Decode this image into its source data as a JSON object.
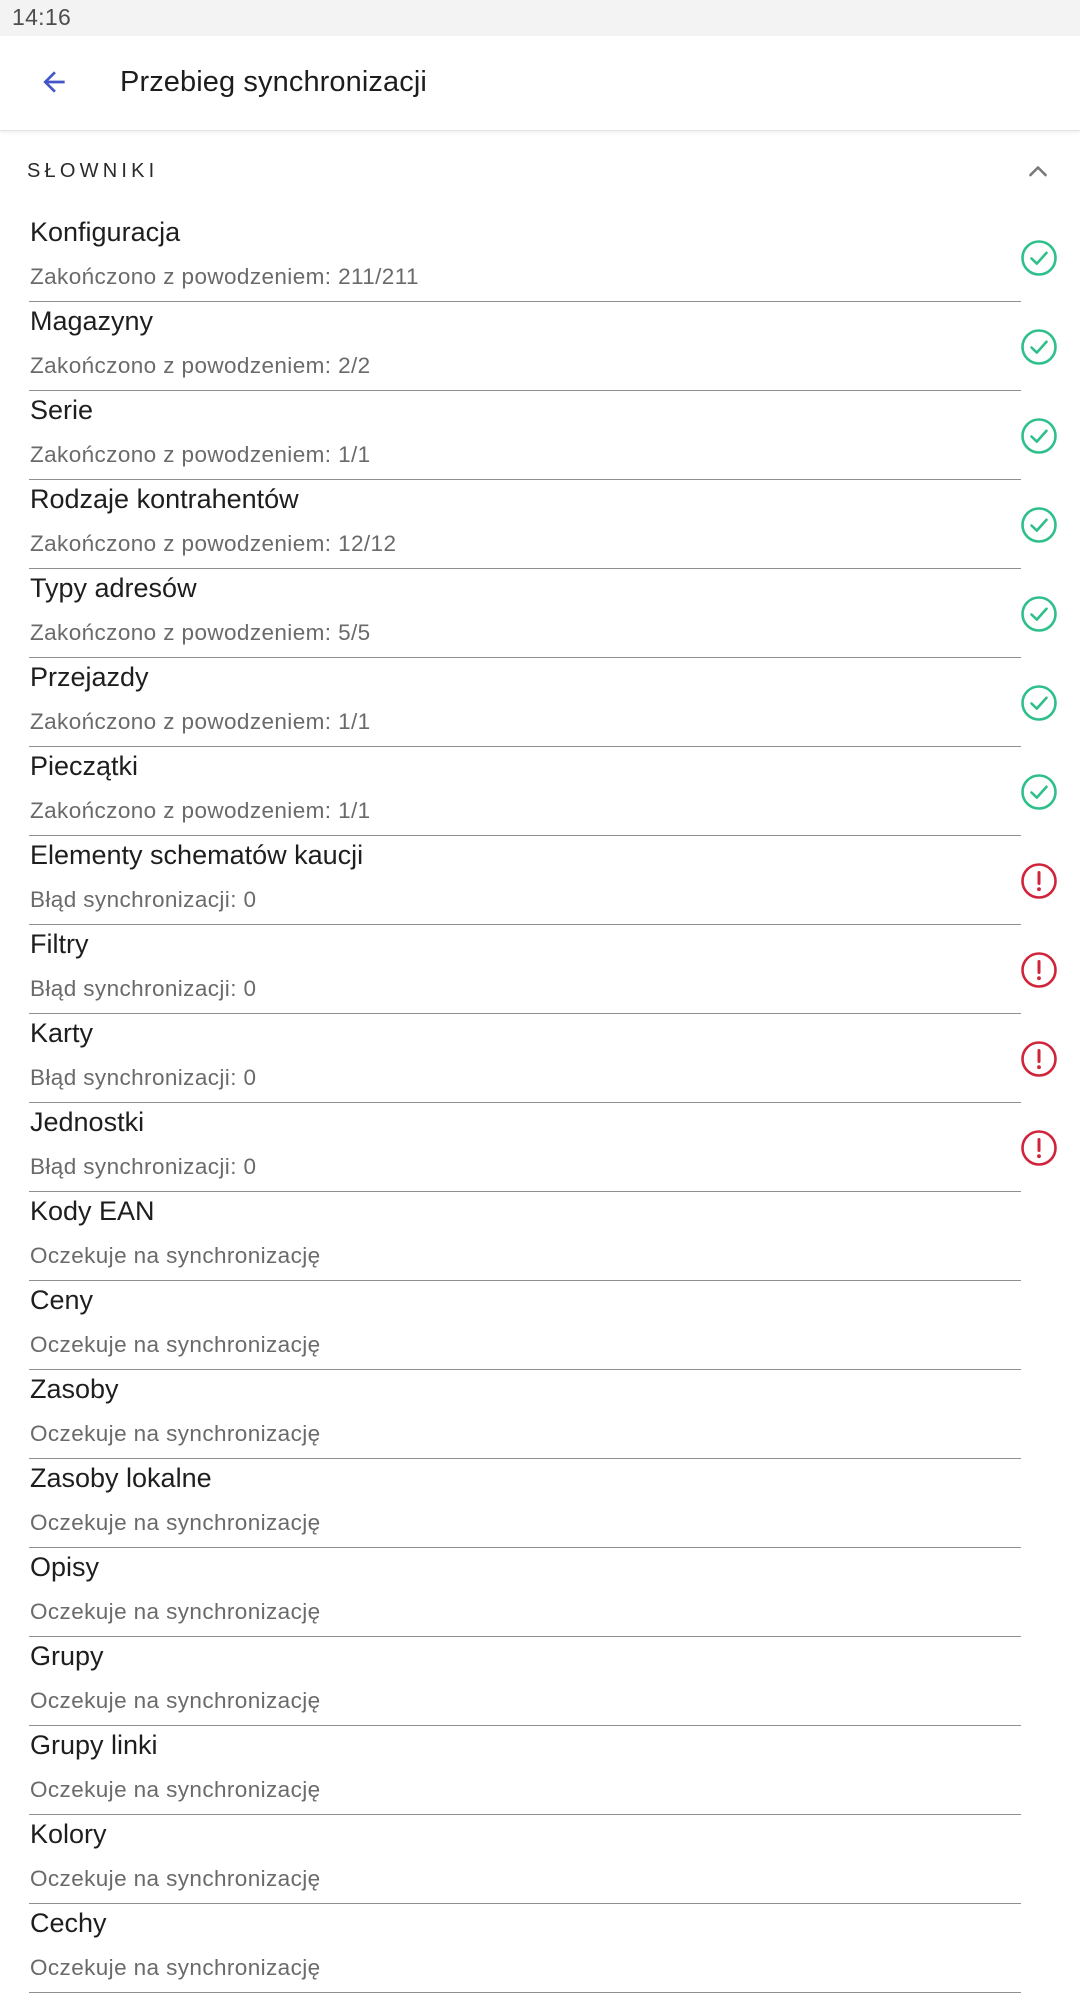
{
  "status_bar": {
    "time": "14:16"
  },
  "app_bar": {
    "title": "Przebieg synchronizacji",
    "back_icon": "arrow-back-icon"
  },
  "colors": {
    "accent": "#4355c8",
    "success": "#2fbf8a",
    "error": "#d0243b",
    "divider": "#8f8f8f"
  },
  "section": {
    "title": "SŁOWNIKI",
    "toggle_icon": "chevron-up-icon",
    "expanded": true
  },
  "items": [
    {
      "title": "Konfiguracja",
      "status": "Zakończono z powodzeniem: 211/211",
      "state": "success"
    },
    {
      "title": "Magazyny",
      "status": "Zakończono z powodzeniem: 2/2",
      "state": "success"
    },
    {
      "title": "Serie",
      "status": "Zakończono z powodzeniem: 1/1",
      "state": "success"
    },
    {
      "title": "Rodzaje kontrahentów",
      "status": "Zakończono z powodzeniem: 12/12",
      "state": "success"
    },
    {
      "title": "Typy adresów",
      "status": "Zakończono z powodzeniem: 5/5",
      "state": "success"
    },
    {
      "title": "Przejazdy",
      "status": "Zakończono z powodzeniem: 1/1",
      "state": "success"
    },
    {
      "title": "Pieczątki",
      "status": "Zakończono z powodzeniem: 1/1",
      "state": "success"
    },
    {
      "title": "Elementy schematów kaucji",
      "status": "Błąd synchronizacji: 0",
      "state": "error"
    },
    {
      "title": "Filtry",
      "status": "Błąd synchronizacji: 0",
      "state": "error"
    },
    {
      "title": "Karty",
      "status": "Błąd synchronizacji: 0",
      "state": "error"
    },
    {
      "title": "Jednostki",
      "status": "Błąd synchronizacji: 0",
      "state": "error"
    },
    {
      "title": "Kody EAN",
      "status": "Oczekuje na synchronizację",
      "state": "pending"
    },
    {
      "title": "Ceny",
      "status": "Oczekuje na synchronizację",
      "state": "pending"
    },
    {
      "title": "Zasoby",
      "status": "Oczekuje na synchronizację",
      "state": "pending"
    },
    {
      "title": "Zasoby lokalne",
      "status": "Oczekuje na synchronizację",
      "state": "pending"
    },
    {
      "title": "Opisy",
      "status": "Oczekuje na synchronizację",
      "state": "pending"
    },
    {
      "title": "Grupy",
      "status": "Oczekuje na synchronizację",
      "state": "pending"
    },
    {
      "title": "Grupy linki",
      "status": "Oczekuje na synchronizację",
      "state": "pending"
    },
    {
      "title": "Kolory",
      "status": "Oczekuje na synchronizację",
      "state": "pending"
    },
    {
      "title": "Cechy",
      "status": "Oczekuje na synchronizację",
      "state": "pending"
    }
  ]
}
